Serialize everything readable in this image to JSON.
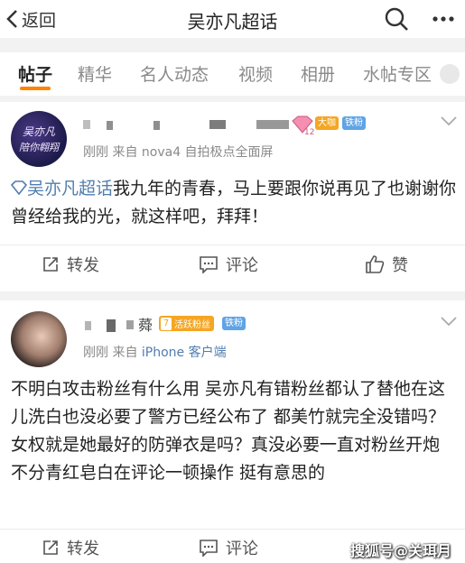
{
  "header": {
    "back_label": "返回",
    "title": "吴亦凡超话"
  },
  "tabs": [
    {
      "label": "帖子",
      "active": true
    },
    {
      "label": "精华"
    },
    {
      "label": "名人动态"
    },
    {
      "label": "视频"
    },
    {
      "label": "相册"
    },
    {
      "label": "水帖专区"
    }
  ],
  "posts": [
    {
      "avatar_text_1": "吴亦凡",
      "avatar_text_2": "陪你翱翔",
      "level": "12",
      "badges": [
        "大咖",
        "铁粉"
      ],
      "meta": "刚刚 来自 nova4 自拍极点全面屏",
      "topic": "吴亦凡超话",
      "text": "我九年的青春，马上要跟你说再见了也谢谢你曾经给我的光，就这样吧，拜拜！",
      "actions": {
        "repost": "转发",
        "comment": "评论",
        "like": "赞"
      }
    },
    {
      "name_visible": "蕣",
      "level": "7",
      "badges": [
        "活跃粉丝",
        "铁粉"
      ],
      "meta_prefix": "刚刚 来自",
      "meta_device": "iPhone 客户端",
      "text": "不明白攻击粉丝有什么用 吴亦凡有错粉丝都认了替他在这儿洗白也没必要了警方已经公布了 都美竹就完全没错吗？女权就是她最好的防弹衣是吗？真没必要一直对粉丝开炮 不分青红皂白在评论一顿操作 挺有意思的",
      "actions": {
        "repost": "转发",
        "comment": "评论"
      }
    }
  ],
  "watermark": "搜狐号@关珥月",
  "colors": {
    "accent": "#ff8200",
    "topic_link": "#507daf",
    "badge_gold": "#f5a623",
    "badge_blue": "#5ea4e6"
  }
}
